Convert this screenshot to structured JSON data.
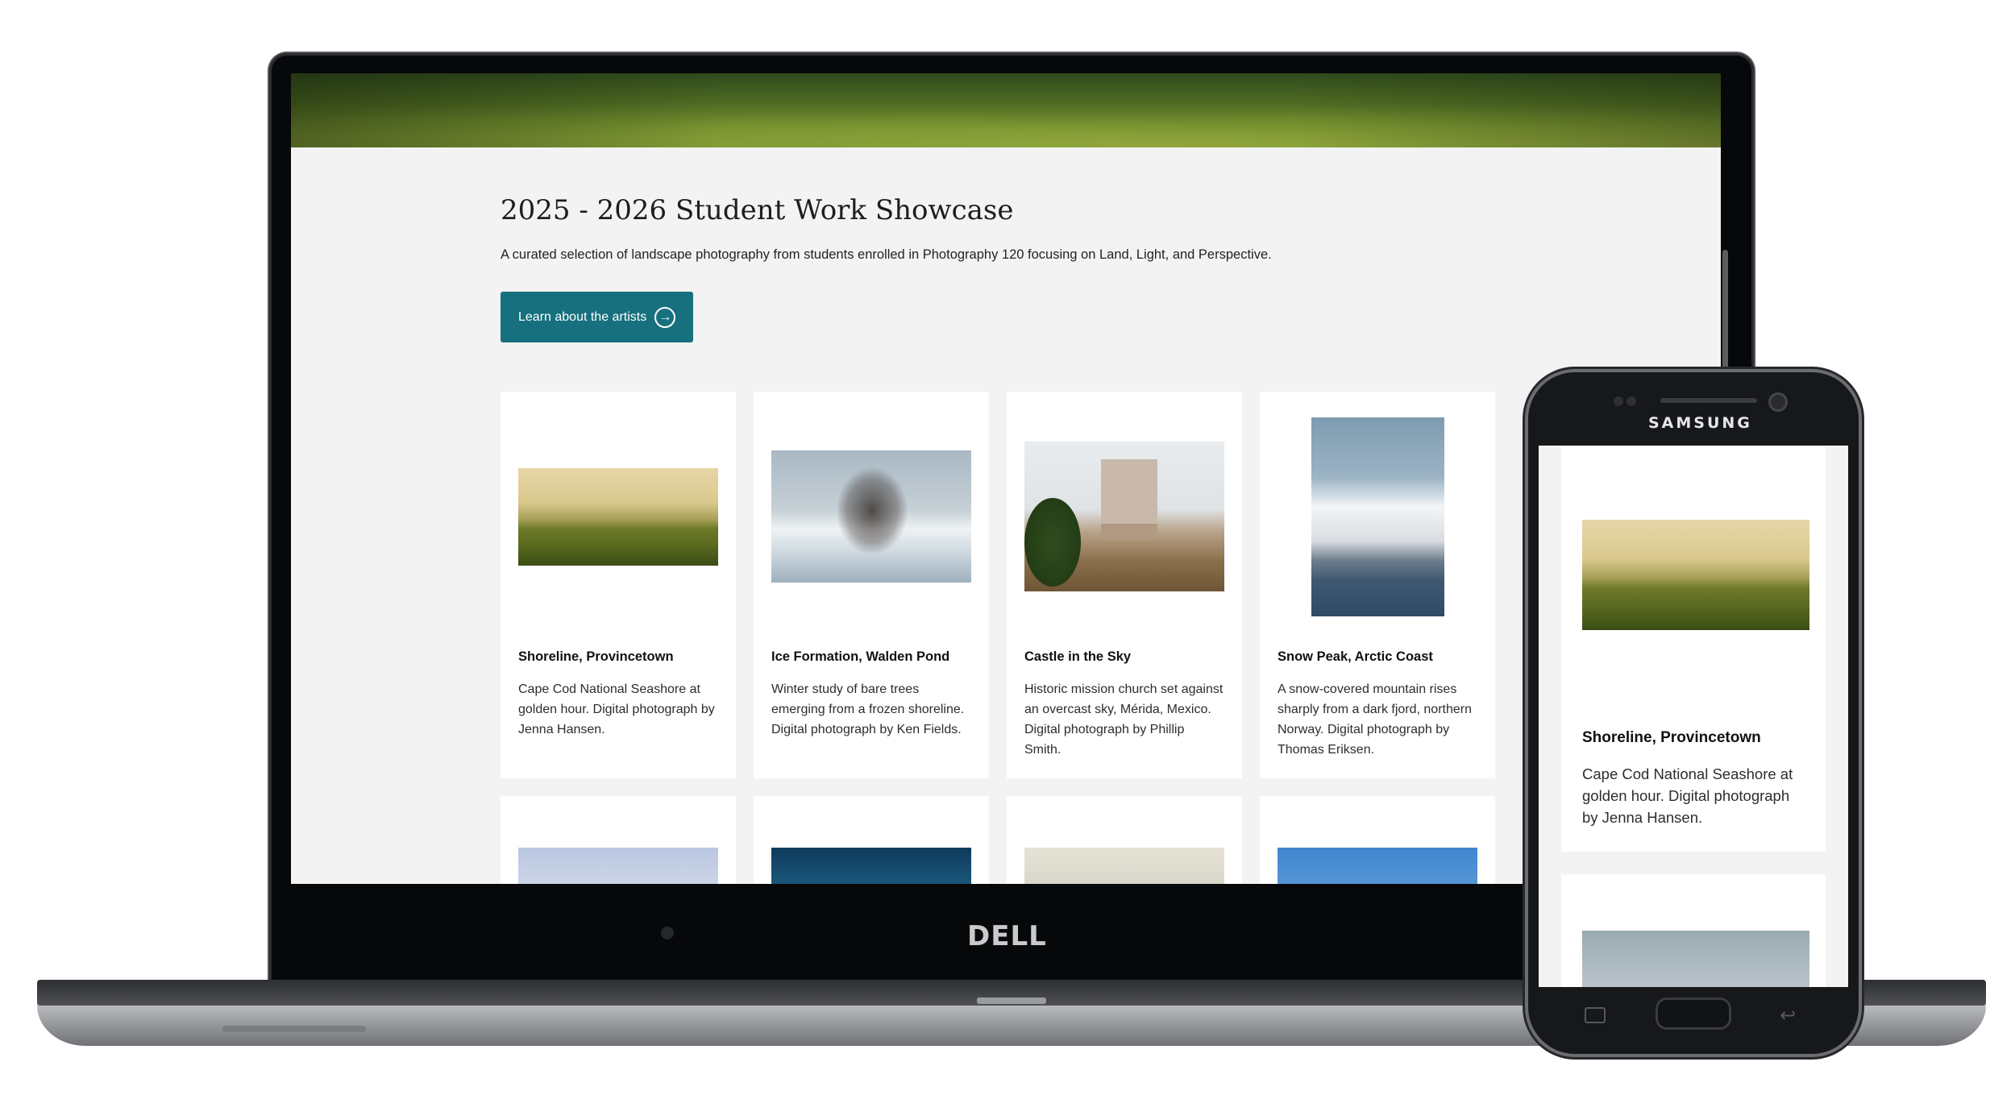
{
  "devices": {
    "laptop_brand": "DELL",
    "phone_brand": "SAMSUNG"
  },
  "page": {
    "title": "2025 - 2026 Student Work Showcase",
    "description": "A curated selection of landscape photography from students enrolled in Photography 120 focusing on Land, Light, and Perspective.",
    "cta_label": "Learn about the artists",
    "cta_icon": "arrow-circle-right-icon",
    "accent_color": "#17707e"
  },
  "cards": [
    {
      "title": "Shoreline, Provincetown",
      "text": "Cape Cod National Seashore at golden hour. Digital photograph by Jenna Hansen."
    },
    {
      "title": "Ice Formation, Walden Pond",
      "text": "Winter study of bare trees emerging from a frozen shoreline. Digital photograph by Ken Fields."
    },
    {
      "title": "Castle in the Sky",
      "text": "Historic mission church set against an overcast sky, Mérida, Mexico. Digital photograph by Phillip Smith."
    },
    {
      "title": "Snow Peak, Arctic Coast",
      "text": "A snow-covered mountain rises sharply from a dark fjord, northern Norway. Digital photograph by Thomas Eriksen."
    }
  ]
}
